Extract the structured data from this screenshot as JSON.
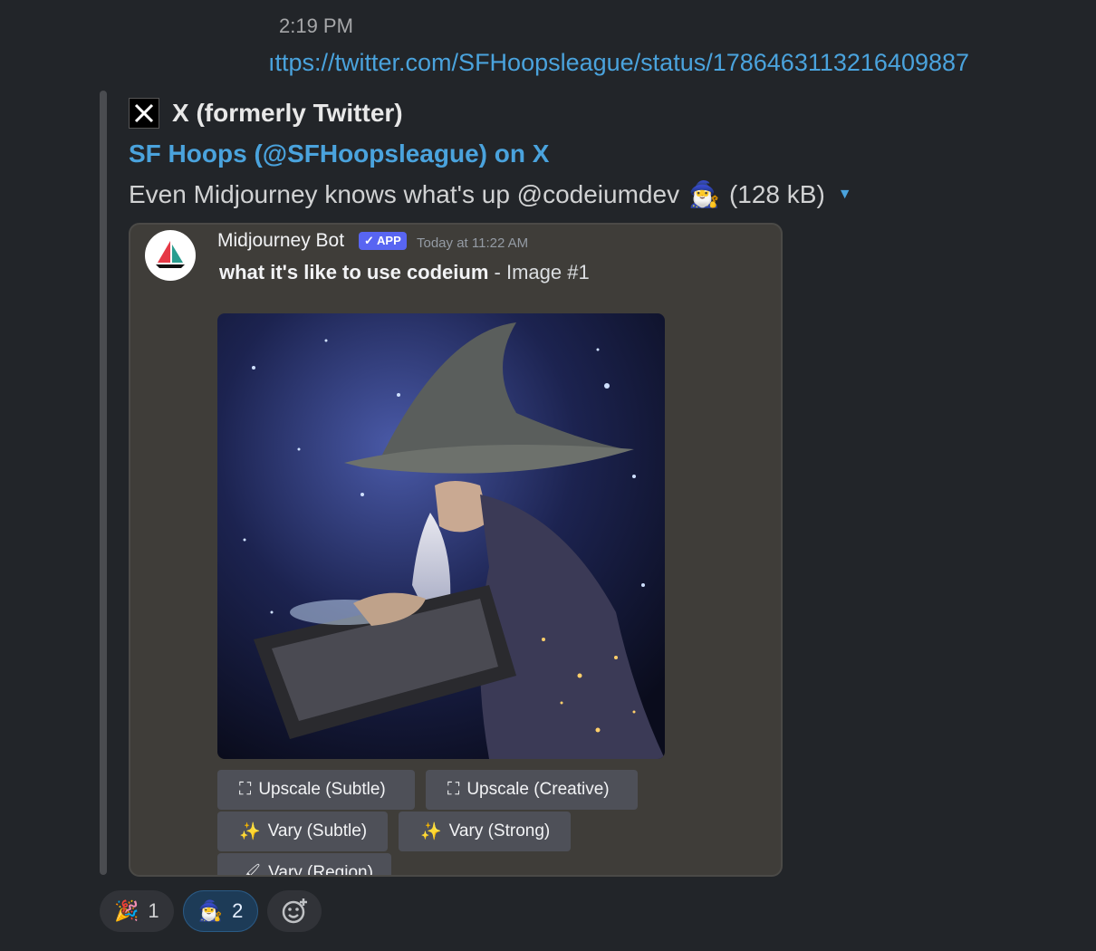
{
  "message": {
    "timestamp": "2:19 PM",
    "link": "ıttps://twitter.com/SFHoopsleague/status/1786463113216409887"
  },
  "unfurl": {
    "provider": "X (formerly Twitter)",
    "title": "SF Hoops (@SFHoopsleague) on X",
    "description": "Even Midjourney knows what's up @codeiumdev",
    "emoji": "🧙‍♂️",
    "size": "(128 kB)"
  },
  "discord": {
    "bot_name": "Midjourney Bot",
    "badge": "✓ APP",
    "time": "Today at 11:22 AM",
    "prompt": "what it's like to use codeium",
    "image_label": "- Image #1",
    "buttons": {
      "upscale_subtle": "Upscale (Subtle)",
      "upscale_creative": "Upscale (Creative)",
      "vary_subtle": "Vary (Subtle)",
      "vary_strong": "Vary (Strong)",
      "vary_region": "Vary (Region)"
    }
  },
  "reactions": [
    {
      "emoji": "🎉",
      "count": "1"
    },
    {
      "emoji": "🧙‍♂️",
      "count": "2"
    }
  ],
  "colors": {
    "link": "#4aa3dd",
    "background": "#222529",
    "card": "#3f3d39",
    "badge": "#5865f2"
  }
}
